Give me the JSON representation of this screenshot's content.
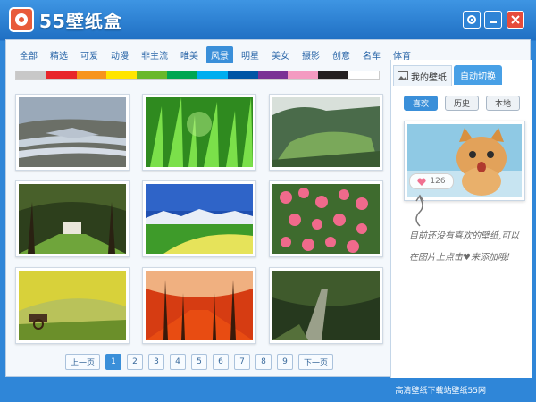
{
  "window": {
    "title": "55壁纸盒"
  },
  "categories": [
    "全部",
    "精选",
    "可爱",
    "动漫",
    "非主流",
    "唯美",
    "风景",
    "明星",
    "美女",
    "摄影",
    "创意",
    "名车",
    "体育"
  ],
  "active_category": "风景",
  "colorbar": {
    "colors": [
      "#c8c8c8",
      "#e8262b",
      "#f7941d",
      "#ffe500",
      "#69b82a",
      "#00a651",
      "#00aeef",
      "#0055a5",
      "#7a3295",
      "#f49ac1",
      "#231f20",
      "#ffffff"
    ]
  },
  "pager": {
    "prev": "上一页",
    "next": "下一页",
    "pages": [
      "1",
      "2",
      "3",
      "4",
      "5",
      "6",
      "7",
      "8",
      "9"
    ],
    "current": "1"
  },
  "side": {
    "tab_mine": "我的壁纸",
    "tab_auto": "自动切换",
    "btn_like": "喜欢",
    "btn_history": "历史",
    "btn_local": "本地",
    "like_count": "126",
    "message": "目前还没有喜欢的壁纸,可以在图片上点击♥来添加哦!"
  },
  "status": {
    "text": "高清壁纸下载站壁纸55网"
  }
}
